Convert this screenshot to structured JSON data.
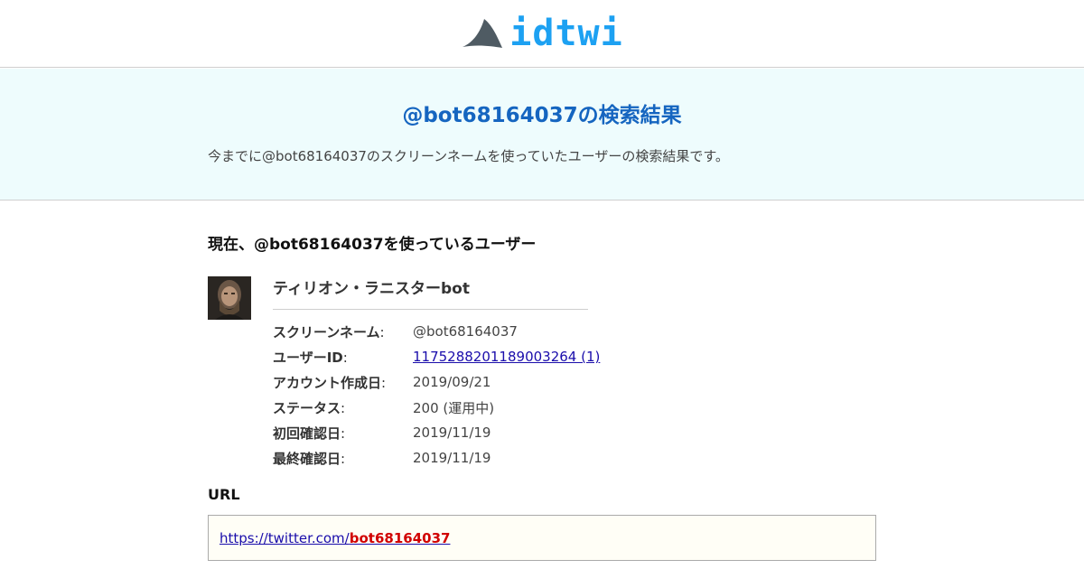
{
  "header": {
    "logo_text": "idtwi",
    "logo_icon": "shark-fin-icon",
    "accent_color": "#1da1f2"
  },
  "hero": {
    "title": "@bot68164037の検索結果",
    "description": "今までに@bot68164037のスクリーンネームを使っていたユーザーの検索結果です。",
    "background": "#eefcfd"
  },
  "current_user": {
    "heading": "現在、@bot68164037を使っているユーザー",
    "name": "ティリオン・ラニスターbot",
    "fields": [
      {
        "label": "スクリーンネーム",
        "suffix": ":",
        "value": "@bot68164037"
      },
      {
        "label": "ユーザーID",
        "suffix": ":",
        "value": "1175288201189003264 (1)"
      },
      {
        "label": "アカウント作成日",
        "suffix": ":",
        "value": "2019/09/21"
      },
      {
        "label": "ステータス",
        "suffix": ":",
        "value": "200 (運用中)"
      },
      {
        "label": "初回確認日",
        "suffix": ":",
        "value": "2019/11/19"
      },
      {
        "label": "最終確認日",
        "suffix": ":",
        "value": "2019/11/19"
      }
    ]
  },
  "url_section": {
    "heading": "URL",
    "url_prefix": "https://twitter.com/",
    "url_handle": "bot68164037"
  }
}
